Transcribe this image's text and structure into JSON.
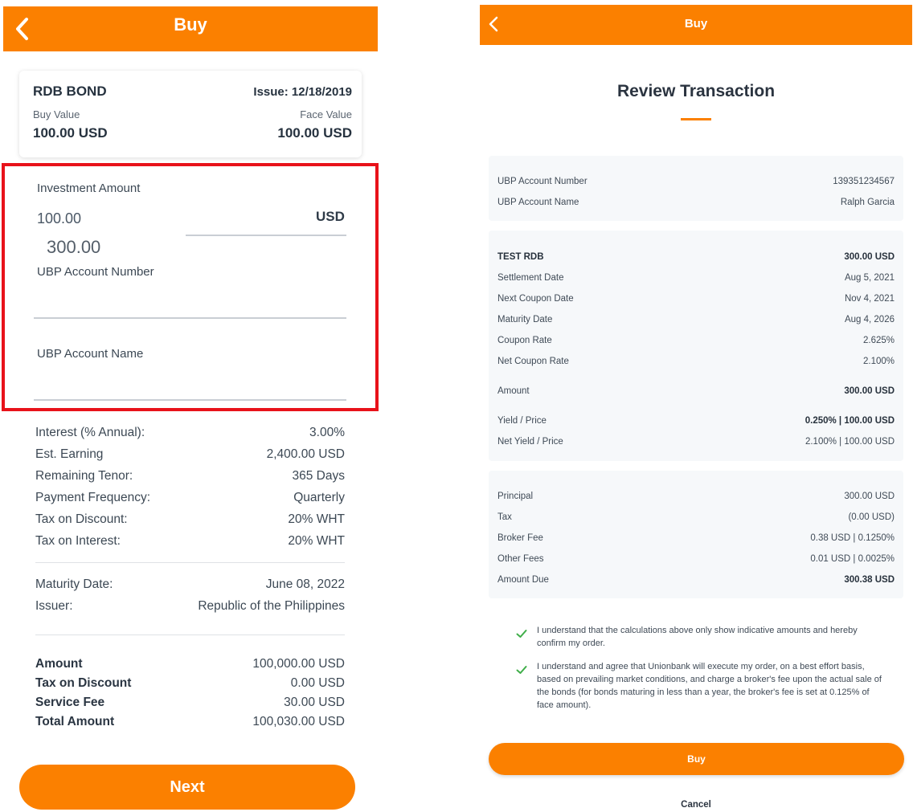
{
  "left": {
    "header_title": "Buy",
    "bond": {
      "name": "RDB BOND",
      "issue": "Issue: 12/18/2019",
      "buy_value_label": "Buy Value",
      "buy_value": "100.00 USD",
      "face_value_label": "Face Value",
      "face_value": "100.00 USD"
    },
    "form": {
      "investment_amount_label": "Investment Amount",
      "investment_amount_value": "100.00",
      "currency": "USD",
      "overlay_value": "300.00",
      "account_number_label": "UBP Account Number",
      "account_name_label": "UBP Account Name"
    },
    "details": [
      {
        "label": "Interest (% Annual):",
        "value": "3.00%"
      },
      {
        "label": "Est. Earning",
        "value": "2,400.00 USD"
      },
      {
        "label": "Remaining Tenor:",
        "value": "365 Days"
      },
      {
        "label": "Payment Frequency:",
        "value": "Quarterly"
      },
      {
        "label": "Tax on Discount:",
        "value": "20% WHT"
      },
      {
        "label": "Tax on Interest:",
        "value": "20% WHT"
      }
    ],
    "maturity": [
      {
        "label": "Maturity Date:",
        "value": "June 08, 2022"
      },
      {
        "label": "Issuer:",
        "value": "Republic of the Philippines"
      }
    ],
    "totals": [
      {
        "label": "Amount",
        "value": "100,000.00 USD"
      },
      {
        "label": "Tax on Discount",
        "value": "0.00 USD"
      },
      {
        "label": "Service Fee",
        "value": "30.00 USD"
      },
      {
        "label": "Total Amount",
        "value": "100,030.00 USD"
      }
    ],
    "next_label": "Next"
  },
  "right": {
    "header_title": "Buy",
    "review_title": "Review Transaction",
    "account": [
      {
        "label": "UBP Account Number",
        "value": "139351234567"
      },
      {
        "label": "UBP Account Name",
        "value": "Ralph Garcia"
      }
    ],
    "bond": [
      {
        "label": "TEST RDB",
        "value": "300.00 USD"
      },
      {
        "label": "Settlement Date",
        "value": "Aug 5, 2021"
      },
      {
        "label": "Next Coupon Date",
        "value": "Nov 4, 2021"
      },
      {
        "label": "Maturity Date",
        "value": "Aug 4, 2026"
      },
      {
        "label": "Coupon Rate",
        "value": "2.625%"
      },
      {
        "label": "Net Coupon Rate",
        "value": "2.100%"
      },
      {
        "label": "Amount",
        "value": "300.00 USD"
      },
      {
        "label": "Yield / Price",
        "value": "0.250% | 100.00 USD"
      },
      {
        "label": "Net Yield / Price",
        "value": "2.100% | 100.00 USD"
      }
    ],
    "fees": [
      {
        "label": "Principal",
        "value": "300.00 USD"
      },
      {
        "label": "Tax",
        "value": "(0.00 USD)"
      },
      {
        "label": "Broker Fee",
        "value": "0.38 USD | 0.1250%"
      },
      {
        "label": "Other Fees",
        "value": "0.01 USD | 0.0025%"
      },
      {
        "label": "Amount Due",
        "value": "300.38 USD"
      }
    ],
    "confirm1": "I understand that the calculations above only show indicative amounts and hereby confirm my order.",
    "confirm2": "I understand and agree that Unionbank will execute my order, on a best effort basis, based on prevailing market conditions, and charge a broker's fee upon the actual sale of the bonds (for bonds maturing in less than a year, the broker's fee is set at 0.125% of face amount).",
    "buy_label": "Buy",
    "cancel_label": "Cancel"
  },
  "colors": {
    "accent": "#fb8000",
    "highlight": "#e8121a",
    "check": "#3fae49"
  },
  "icons": [
    "chevron-left-icon",
    "check-icon"
  ]
}
